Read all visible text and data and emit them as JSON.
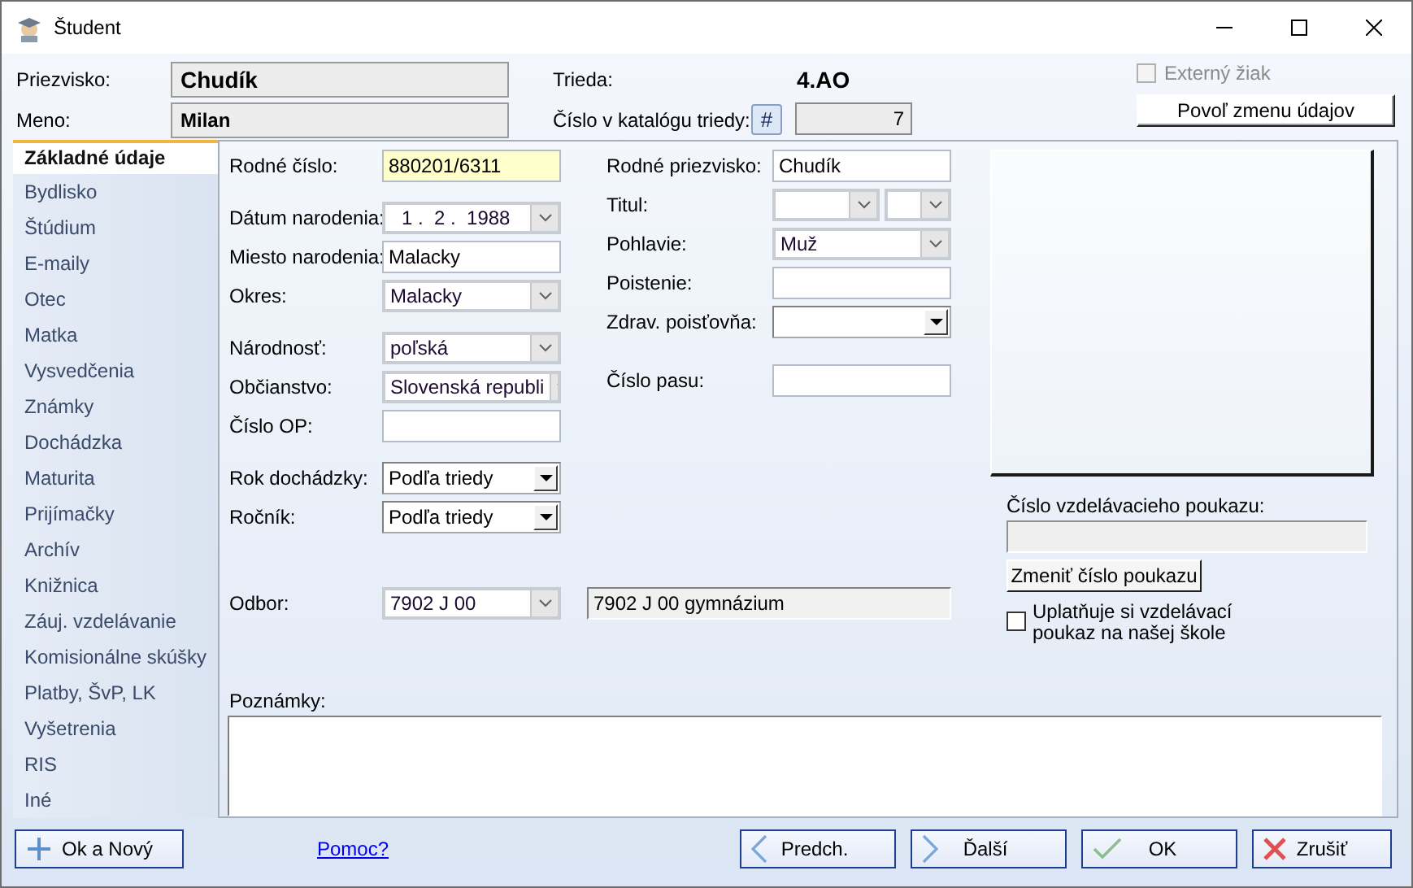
{
  "window": {
    "title": "Študent"
  },
  "header": {
    "surname": {
      "label": "Priezvisko:",
      "value": "Chudík"
    },
    "first_name": {
      "label": "Meno:",
      "value": "Milan"
    },
    "class": {
      "label": "Trieda:",
      "value": "4.AO"
    },
    "catalog_number": {
      "label": "Číslo v katalógu triedy:",
      "button": "#",
      "value": "7"
    },
    "external_student": {
      "label": "Externý žiak",
      "checked": false,
      "disabled": true
    },
    "unlock_button": "Povoľ zmenu údajov"
  },
  "sidebar": {
    "items": [
      {
        "label": "Základné údaje",
        "selected": true
      },
      {
        "label": "Bydlisko",
        "selected": false
      },
      {
        "label": "Štúdium",
        "selected": false
      },
      {
        "label": "E-maily",
        "selected": false
      },
      {
        "label": "Otec",
        "selected": false
      },
      {
        "label": "Matka",
        "selected": false
      },
      {
        "label": "Vysvedčenia",
        "selected": false
      },
      {
        "label": "Známky",
        "selected": false
      },
      {
        "label": "Dochádzka",
        "selected": false
      },
      {
        "label": "Maturita",
        "selected": false
      },
      {
        "label": "Prijímačky",
        "selected": false
      },
      {
        "label": "Archív",
        "selected": false
      },
      {
        "label": "Knižnica",
        "selected": false
      },
      {
        "label": "Záuj. vzdelávanie",
        "selected": false
      },
      {
        "label": "Komisionálne skúšky",
        "selected": false
      },
      {
        "label": "Platby, ŠvP, LK",
        "selected": false
      },
      {
        "label": "Vyšetrenia",
        "selected": false
      },
      {
        "label": "RIS",
        "selected": false
      },
      {
        "label": "Iné",
        "selected": false
      }
    ]
  },
  "form": {
    "column_1": [
      [
        {
          "label": "Rodné číslo:",
          "kind": "text",
          "value": "880201/6311",
          "highlighted": true
        }
      ],
      [
        {
          "label": "Dátum narodenia:",
          "kind": "date",
          "value": "1 .  2 .  1988",
          "highlighted": false
        },
        {
          "label": "Miesto narodenia:",
          "kind": "text",
          "value": "Malacky",
          "highlighted": false
        },
        {
          "label": "Okres:",
          "kind": "combo",
          "value": "Malacky",
          "highlighted": false
        }
      ],
      [
        {
          "label": "Národnosť:",
          "kind": "combo",
          "value": "poľská",
          "highlighted": false
        },
        {
          "label": "Občianstvo:",
          "kind": "combo",
          "value": "Slovenská republi",
          "highlighted": false
        },
        {
          "label": "Číslo OP:",
          "kind": "text",
          "highlighted": false
        }
      ],
      [
        {
          "label": "Rok dochádzky:",
          "kind": "dropdown",
          "value": "Podľa triedy",
          "highlighted": false
        },
        {
          "label": "Ročník:",
          "kind": "dropdown",
          "value": "Podľa triedy",
          "highlighted": false
        }
      ]
    ],
    "column_2": [
      [
        {
          "label": "Rodné priezvisko:",
          "kind": "text",
          "value": "Chudík",
          "highlighted": false
        },
        {
          "label": "Titul:",
          "kind": "combo-pair",
          "highlighted": false
        },
        {
          "label": "Pohlavie:",
          "kind": "combo",
          "value": "Muž",
          "highlighted": false
        },
        {
          "label": "Poistenie:",
          "kind": "text",
          "highlighted": false
        },
        {
          "label": "Zdrav. poisťovňa:",
          "kind": "dropdown",
          "highlighted": false
        }
      ],
      [
        {
          "label": "Číslo pasu:",
          "kind": "text",
          "highlighted": false
        }
      ]
    ],
    "field_of_study": {
      "label": "Odbor:",
      "value": "7902 J 00",
      "description": "7902 J 00 gymnázium"
    },
    "notes": {
      "label": "Poznámky:"
    }
  },
  "voucher": {
    "label": "Číslo vzdelávacieho poukazu:",
    "button": "Zmeniť číslo poukazu",
    "claims_voucher": {
      "label": "Uplatňuje si vzdelávací poukaz na našej škole",
      "checked": false
    }
  },
  "footer": {
    "ok_new": "Ok a Nový",
    "help_link": "Pomoc?",
    "buttons": [
      {
        "kind": "previous",
        "label": "Predch."
      },
      {
        "kind": "next",
        "label": "Ďalší"
      },
      {
        "kind": "ok",
        "label": "OK"
      },
      {
        "kind": "cancel",
        "label": "Zrušiť"
      }
    ]
  }
}
